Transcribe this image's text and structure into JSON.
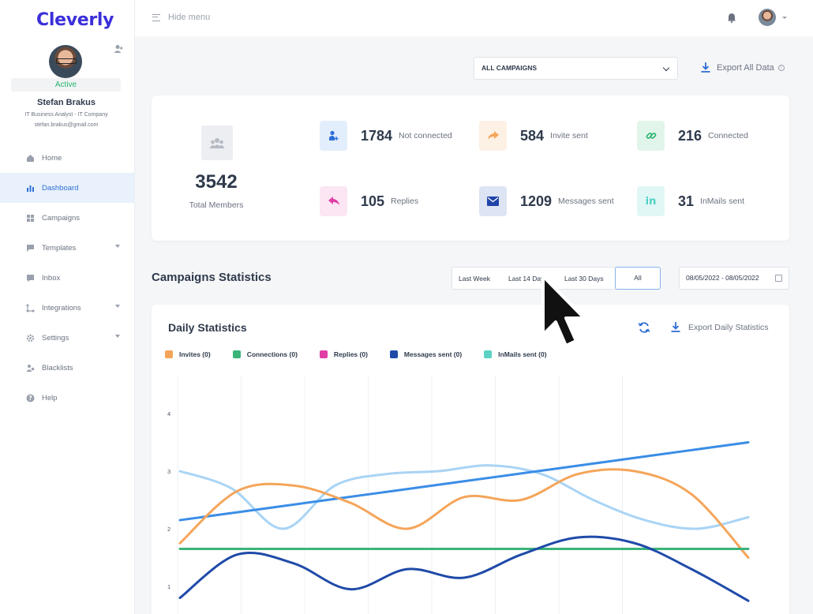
{
  "brand": {
    "logo": "Cleverly"
  },
  "profile": {
    "status": "Active",
    "name": "Stefan Brakus",
    "role": "IT Business Analyst - IT Company",
    "email": "stefan.brakus@gmail.com"
  },
  "nav": [
    {
      "label": "Home",
      "icon": "home-icon",
      "active": false,
      "caret": false
    },
    {
      "label": "Dashboard",
      "icon": "bar-chart-icon",
      "active": true,
      "caret": false
    },
    {
      "label": "Campaigns",
      "icon": "grid-icon",
      "active": false,
      "caret": false
    },
    {
      "label": "Templates",
      "icon": "chat-icon",
      "active": false,
      "caret": true
    },
    {
      "label": "Inbox",
      "icon": "inbox-icon",
      "active": false,
      "caret": false
    },
    {
      "label": "Integrations",
      "icon": "integrations-icon",
      "active": false,
      "caret": true
    },
    {
      "label": "Settings",
      "icon": "gear-icon",
      "active": false,
      "caret": true
    },
    {
      "label": "Blacklists",
      "icon": "users-icon",
      "active": false,
      "caret": false
    },
    {
      "label": "Help",
      "icon": "help-icon",
      "active": false,
      "caret": false
    }
  ],
  "topbar": {
    "hide_menu": "Hide menu"
  },
  "filters": {
    "campaign_select": "ALL CAMPAIGNS",
    "export_all": "Export All Data"
  },
  "stats": {
    "total": {
      "value": "3542",
      "label": "Total Members"
    },
    "items": [
      {
        "value": "1784",
        "label": "Not connected",
        "icon": "user-plus-icon",
        "bg": "#e3eefc",
        "fg": "#2f6fd6"
      },
      {
        "value": "584",
        "label": "Invite sent",
        "icon": "share-arrow-icon",
        "bg": "#fdf0e4",
        "fg": "#f5a55a"
      },
      {
        "value": "216",
        "label": "Connected",
        "icon": "link-icon",
        "bg": "#e2f5eb",
        "fg": "#25b46d"
      },
      {
        "value": "105",
        "label": "Replies",
        "icon": "reply-icon",
        "bg": "#fce6f3",
        "fg": "#e03fa6"
      },
      {
        "value": "1209",
        "label": "Messages sent",
        "icon": "envelope-icon",
        "bg": "#dde4f3",
        "fg": "#2044a8"
      },
      {
        "value": "31",
        "label": "InMails sent",
        "icon": "linkedin-icon",
        "bg": "#e0f7f5",
        "fg": "#4fd1c5"
      }
    ]
  },
  "campaign_stats": {
    "title": "Campaigns Statistics",
    "ranges": [
      "Last Week",
      "Last 14 Days",
      "Last 30 Days",
      "All"
    ],
    "active_range": "All",
    "date_range": "08/05/2022 - 08/05/2022"
  },
  "daily": {
    "title": "Daily Statistics",
    "export_label": "Export Daily Statistics"
  },
  "chart_data": {
    "type": "line",
    "title": "Daily Statistics",
    "ylim": [
      0.5,
      4.5
    ],
    "yticks": [
      1,
      2,
      3,
      4
    ],
    "grid": "vertical",
    "legend": "top-left",
    "series": [
      {
        "name": "Invites (0)",
        "color": "#f5a55a",
        "values": [
          1.75,
          2.65,
          2.75,
          2.45,
          2.0,
          2.55,
          2.5,
          2.95,
          3.0,
          2.6,
          1.5
        ]
      },
      {
        "name": "Connections (0)",
        "color": "#3bb47a",
        "values": [
          1.65,
          1.65,
          1.65,
          1.65,
          1.65,
          1.65,
          1.65,
          1.65,
          1.65,
          1.65,
          1.65
        ]
      },
      {
        "name": "Replies (0)",
        "color": "#e03fa6",
        "values": []
      },
      {
        "name": "Messages sent (0)",
        "color": "#1f4aa8",
        "values": [
          0.8,
          1.55,
          1.4,
          0.95,
          1.3,
          1.15,
          1.55,
          1.85,
          1.75,
          1.3,
          0.75
        ]
      },
      {
        "name": "InMails sent (0)",
        "color": "#5cd2c4",
        "values": []
      },
      {
        "name": "",
        "color": "#a9d4f5",
        "values": [
          3.0,
          2.7,
          2.0,
          2.75,
          2.95,
          3.0,
          3.1,
          2.95,
          2.5,
          2.15,
          2.0,
          2.2
        ]
      },
      {
        "name": "",
        "color": "#3a8de6",
        "values": [
          2.15,
          2.3,
          2.45,
          2.6,
          2.75,
          2.9,
          3.05,
          3.2,
          3.35,
          3.5
        ]
      }
    ]
  }
}
